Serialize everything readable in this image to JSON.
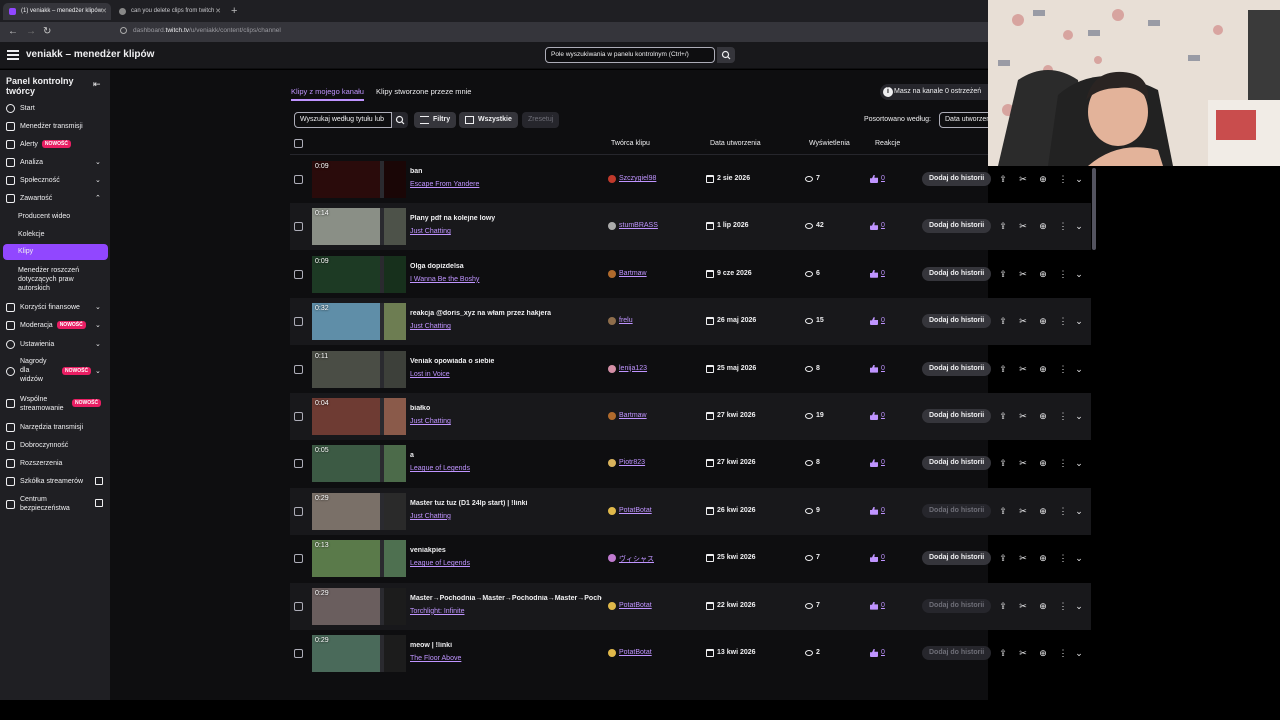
{
  "browser": {
    "tabs": [
      {
        "title": "(1) veniakk – menedżer klipów"
      },
      {
        "title": "can you delete clips from twitch"
      }
    ],
    "url_prefix": "dashboard.",
    "url_host": "twitch.tv",
    "url_path": "/u/veniakk/content/clips/channel"
  },
  "topbar": {
    "title": "veniakk – menedżer klipów",
    "search_placeholder": "Pole wyszukiwania w panelu kontrolnym (Ctrl+/)"
  },
  "sidebar": {
    "title": "Panel kontrolny twórcy",
    "badge": "NOWOŚĆ",
    "items": [
      {
        "label": "Start"
      },
      {
        "label": "Menedżer transmisji"
      },
      {
        "label": "Alerty"
      },
      {
        "label": "Analiza"
      },
      {
        "label": "Społeczność"
      },
      {
        "label": "Zawartość"
      },
      {
        "label": "Producent wideo"
      },
      {
        "label": "Kolekcje"
      },
      {
        "label": "Klipy"
      },
      {
        "label": "Menedżer roszczeń dotyczących praw autorskich"
      },
      {
        "label": "Korzyści finansowe"
      },
      {
        "label": "Moderacja"
      },
      {
        "label": "Ustawienia"
      },
      {
        "label": "Nagrody dla widzów"
      },
      {
        "label": "Wspólne streamowanie"
      },
      {
        "label": "Narzędzia transmisji"
      },
      {
        "label": "Dobroczynność"
      },
      {
        "label": "Rozszerzenia"
      },
      {
        "label": "Szkółka streamerów"
      },
      {
        "label": "Centrum bezpieczeństwa"
      }
    ]
  },
  "main": {
    "tabs": [
      {
        "label": "Klipy z mojego kanału"
      },
      {
        "label": "Klipy stworzone przeze mnie"
      }
    ],
    "notice": "Masz na kanale 0 ostrzeżeń",
    "filter_placeholder": "Wyszukaj według tytułu lub",
    "filters_label": "Filtry",
    "all_label": "Wszystkie",
    "reset_label": "Zresetuj",
    "sort_label": "Posortowano według:",
    "sort_value": "Data utworzenia",
    "columns": {
      "creator": "Twórca klipu",
      "date": "Data utworzenia",
      "views": "Wyświetlenia",
      "reactions": "Reakcje"
    },
    "add_label": "Dodaj do historii",
    "clips": [
      {
        "duration": "0:09",
        "title": "ban",
        "game": "Escape From Yandere",
        "creator": "Szczygiel98",
        "date": "2 sie 2026",
        "views": "7",
        "reactions": "0",
        "add_enabled": true,
        "c1": "#2a0b0b",
        "c2": "#1a0606",
        "av": "#c0392b"
      },
      {
        "duration": "0:14",
        "title": "Plany pdf na kolejne lowy",
        "game": "Just Chatting",
        "creator": "stumBRASS",
        "date": "1 lip 2026",
        "views": "42",
        "reactions": "0",
        "add_enabled": true,
        "c1": "#8a8f86",
        "c2": "#4d5249",
        "av": "#aaaaaa"
      },
      {
        "duration": "0:09",
        "title": "Olga dopizdelsa",
        "game": "I Wanna Be the Boshy",
        "creator": "Bartmaw",
        "date": "9 cze 2026",
        "views": "6",
        "reactions": "0",
        "add_enabled": true,
        "c1": "#1d3a24",
        "c2": "#17301c",
        "av": "#b06a2c"
      },
      {
        "duration": "0:32",
        "title": "reakcja @doris_xyz na włam przez hakjera",
        "game": "Just Chatting",
        "creator": "frelu",
        "date": "26 maj 2026",
        "views": "15",
        "reactions": "0",
        "add_enabled": true,
        "c1": "#5f8ea8",
        "c2": "#6d7d52",
        "av": "#8e6d4b"
      },
      {
        "duration": "0:11",
        "title": "Veniak opowiada o siebie",
        "game": "Lost in Voice",
        "creator": "lenija123",
        "date": "25 maj 2026",
        "views": "8",
        "reactions": "0",
        "add_enabled": true,
        "c1": "#4a4d45",
        "c2": "#3d403a",
        "av": "#d48fa6"
      },
      {
        "duration": "0:04",
        "title": "białko",
        "game": "Just Chatting",
        "creator": "Bartmaw",
        "date": "27 kwi 2026",
        "views": "19",
        "reactions": "0",
        "add_enabled": true,
        "c1": "#6e3b33",
        "c2": "#8a5a4a",
        "av": "#b06a2c"
      },
      {
        "duration": "0:05",
        "title": "a",
        "game": "League of Legends",
        "creator": "Piotr823",
        "date": "27 kwi 2026",
        "views": "8",
        "reactions": "0",
        "add_enabled": true,
        "c1": "#3c5a44",
        "c2": "#4c6b4a",
        "av": "#d9b35c"
      },
      {
        "duration": "0:29",
        "title": "Master tuz tuz (D1 24lp start) | !linki",
        "game": "Just Chatting",
        "creator": "PotatBotat",
        "date": "26 kwi 2026",
        "views": "9",
        "reactions": "0",
        "add_enabled": false,
        "c1": "#7a7068",
        "c2": "#2a2a2a",
        "av": "#e0b84a"
      },
      {
        "duration": "0:13",
        "title": "veniakpies",
        "game": "League of Legends",
        "creator": "ヴィシャス",
        "date": "25 kwi 2026",
        "views": "7",
        "reactions": "0",
        "add_enabled": true,
        "c1": "#5a7a4a",
        "c2": "#4e7050",
        "av": "#c07ad0"
      },
      {
        "duration": "0:29",
        "title": "Master→Pochodnia→Master→Pochodnia→Master→Pochodnia",
        "game": "Torchlight: Infinite",
        "creator": "PotatBotat",
        "date": "22 kwi 2026",
        "views": "7",
        "reactions": "0",
        "add_enabled": false,
        "c1": "#6a5e5e",
        "c2": "#1c1c1c",
        "av": "#e0b84a"
      },
      {
        "duration": "0:29",
        "title": "meow | !linki",
        "game": "The Floor Above",
        "creator": "PotatBotat",
        "date": "13 kwi 2026",
        "views": "2",
        "reactions": "0",
        "add_enabled": false,
        "c1": "#4a6a5a",
        "c2": "#1c1c1c",
        "av": "#e0b84a"
      }
    ]
  },
  "colors": {
    "accent": "#9147ff",
    "link": "#bf94ff",
    "badge": "#e91e63"
  }
}
